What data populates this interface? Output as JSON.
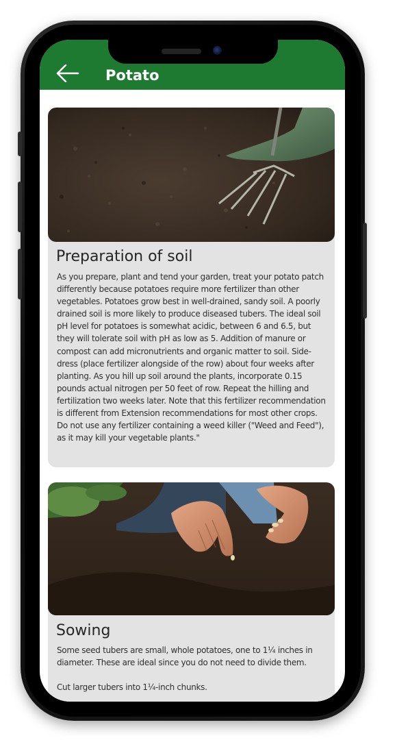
{
  "appbar": {
    "title": "Potato",
    "back_icon": "back-arrow-icon"
  },
  "colors": {
    "appbar": "#1e7a31",
    "card": "#e3e3e3"
  },
  "sections": [
    {
      "title": "Preparation of soil",
      "image": "soil-with-garden-fork",
      "text": "As you prepare, plant and tend your garden, treat your potato patch differently because potatoes require more fertilizer than other vegetables. Potatoes grow best in well-drained, sandy soil. A poorly drained soil is more likely to produce diseased tubers. The ideal soil pH level for potatoes is somewhat acidic, between 6 and 6.5, but they will tolerate soil with pH as low as 5. Addition of manure or compost can add micronutrients and organic matter to soil. Side-dress (place fertilizer alongside of the row) about four weeks after planting. As you hill up soil around the plants, incorporate 0.15 pounds actual nitrogen per 50 feet of row. Repeat the hilling and fertilization two weeks later. Note that this fertilizer recommendation is different from Extension recommendations for most other crops. Do not use any fertilizer containing a weed killer (\"Weed and Feed\"), as it may kill your vegetable plants.\""
    },
    {
      "title": "Sowing",
      "image": "hands-sowing-seeds",
      "text": "Some seed tubers are small, whole potatoes, one to 1¼ inches in diameter. These are ideal since you do not need to divide them.\n\nCut larger tubers into 1¼-inch chunks."
    }
  ]
}
